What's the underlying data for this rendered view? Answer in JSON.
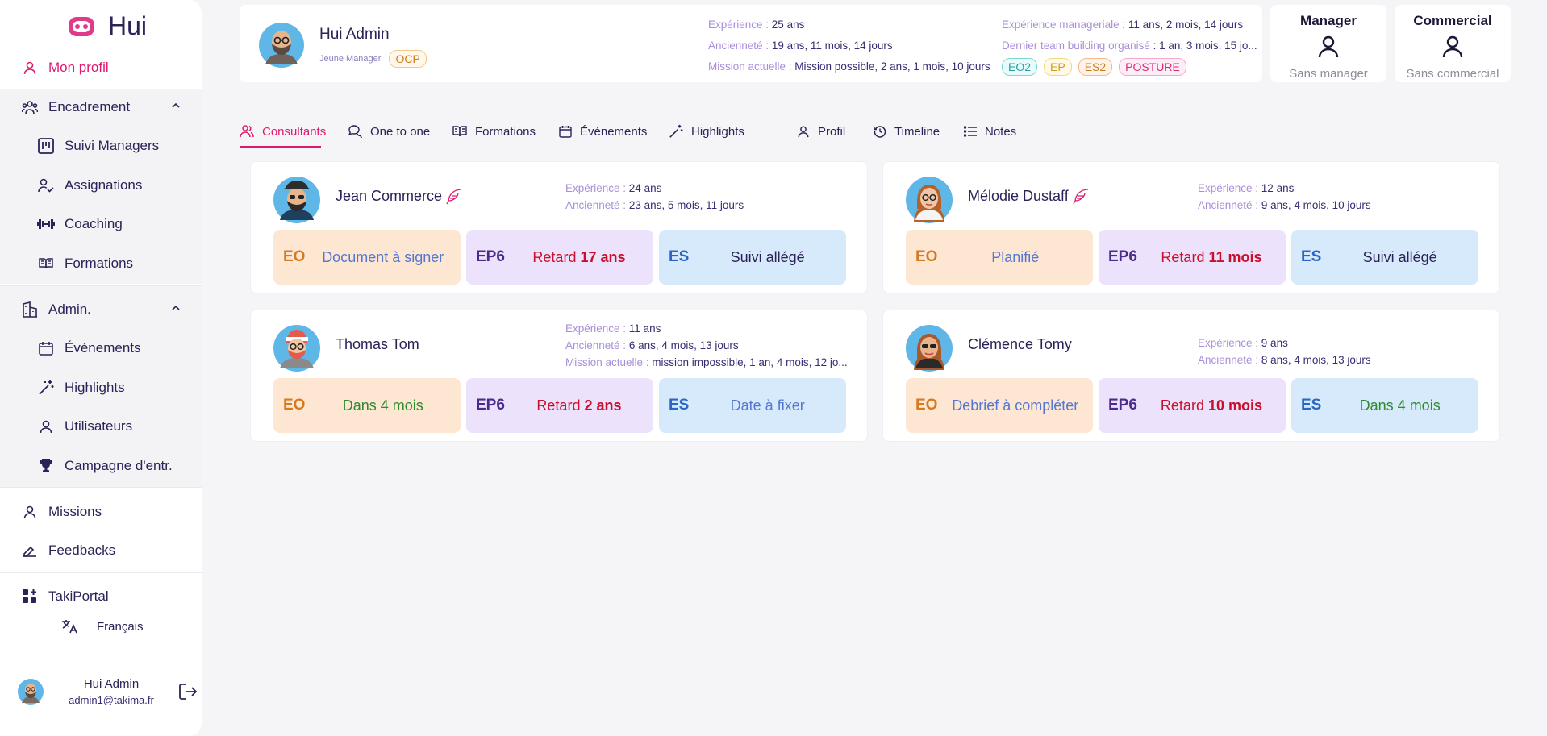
{
  "app": {
    "name": "Hui"
  },
  "sidebar": {
    "profile": "Mon profil",
    "encadrement": "Encadrement",
    "suivi_managers": "Suivi Managers",
    "assignations": "Assignations",
    "coaching": "Coaching",
    "formations": "Formations",
    "admin": "Admin.",
    "evenements": "Événements",
    "highlights": "Highlights",
    "utilisateurs": "Utilisateurs",
    "campagne": "Campagne d'entr.",
    "missions": "Missions",
    "feedbacks": "Feedbacks",
    "takiportal": "TakiPortal",
    "language": "Français",
    "user_name": "Hui Admin",
    "user_email": "admin1@takima.fr",
    "active_color": "#e0196f"
  },
  "header": {
    "name": "Hui Admin",
    "role": "Jeune Manager",
    "tag": "OCP",
    "experience_k": "Expérience : ",
    "experience_v": "25 ans",
    "anciennete_k": "Ancienneté : ",
    "anciennete_v": "19 ans, 11 mois, 14 jours",
    "mission_k": "Mission actuelle : ",
    "mission_v": "Mission possible, 2 ans, 1 mois, 10 jours",
    "exp_mgr_k": "Expérience manageriale",
    "exp_mgr_v": " : 11 ans, 2 mois, 14 jours",
    "team_k": "Dernier team building organisé",
    "team_v": " : 1 an, 3 mois, 15 jo...",
    "tags": [
      "EO2",
      "EP",
      "ES2",
      "POSTURE"
    ]
  },
  "manager_card": {
    "title": "Manager",
    "subtitle": "Sans manager"
  },
  "commercial_card": {
    "title": "Commercial",
    "subtitle": "Sans commercial"
  },
  "tabs": [
    "Consultants",
    "One to one",
    "Formations",
    "Événements",
    "Highlights",
    "Profil",
    "Timeline",
    "Notes"
  ],
  "consultants": [
    {
      "name": "Jean Commerce",
      "experience": "24 ans",
      "anciennete": "23 ans, 5 mois, 11 jours",
      "eo_label": "EO",
      "eo_value": "Document à signer",
      "ep_label": "EP6",
      "ep_prefix": "Retard ",
      "ep_value": "17 ans",
      "es_label": "ES",
      "es_value": "Suivi allégé"
    },
    {
      "name": "Mélodie Dustaff",
      "experience": "12 ans",
      "anciennete": "9 ans, 4 mois, 10 jours",
      "eo_label": "EO",
      "eo_value": "Planifié",
      "ep_label": "EP6",
      "ep_prefix": "Retard ",
      "ep_value": "11 mois",
      "es_label": "ES",
      "es_value": "Suivi allégé"
    },
    {
      "name": "Thomas Tom",
      "experience": "11 ans",
      "anciennete": "6 ans, 4 mois, 13 jours",
      "mission": "mission impossible, 1 an, 4 mois, 12 jo...",
      "eo_label": "EO",
      "eo_value": "Dans 4 mois",
      "ep_label": "EP6",
      "ep_prefix": "Retard ",
      "ep_value": "2 ans",
      "es_label": "ES",
      "es_value": "Date à fixer"
    },
    {
      "name": "Clémence Tomy",
      "experience": "9 ans",
      "anciennete": "8 ans, 4 mois, 13 jours",
      "eo_label": "EO",
      "eo_value": "Debrief à compléter",
      "ep_label": "EP6",
      "ep_prefix": "Retard ",
      "ep_value": "10 mois",
      "es_label": "ES",
      "es_value": "Dans 4 mois"
    }
  ],
  "labels": {
    "experience": "Expérience : ",
    "anciennete": "Ancienneté : ",
    "mission": "Mission actuelle : "
  }
}
